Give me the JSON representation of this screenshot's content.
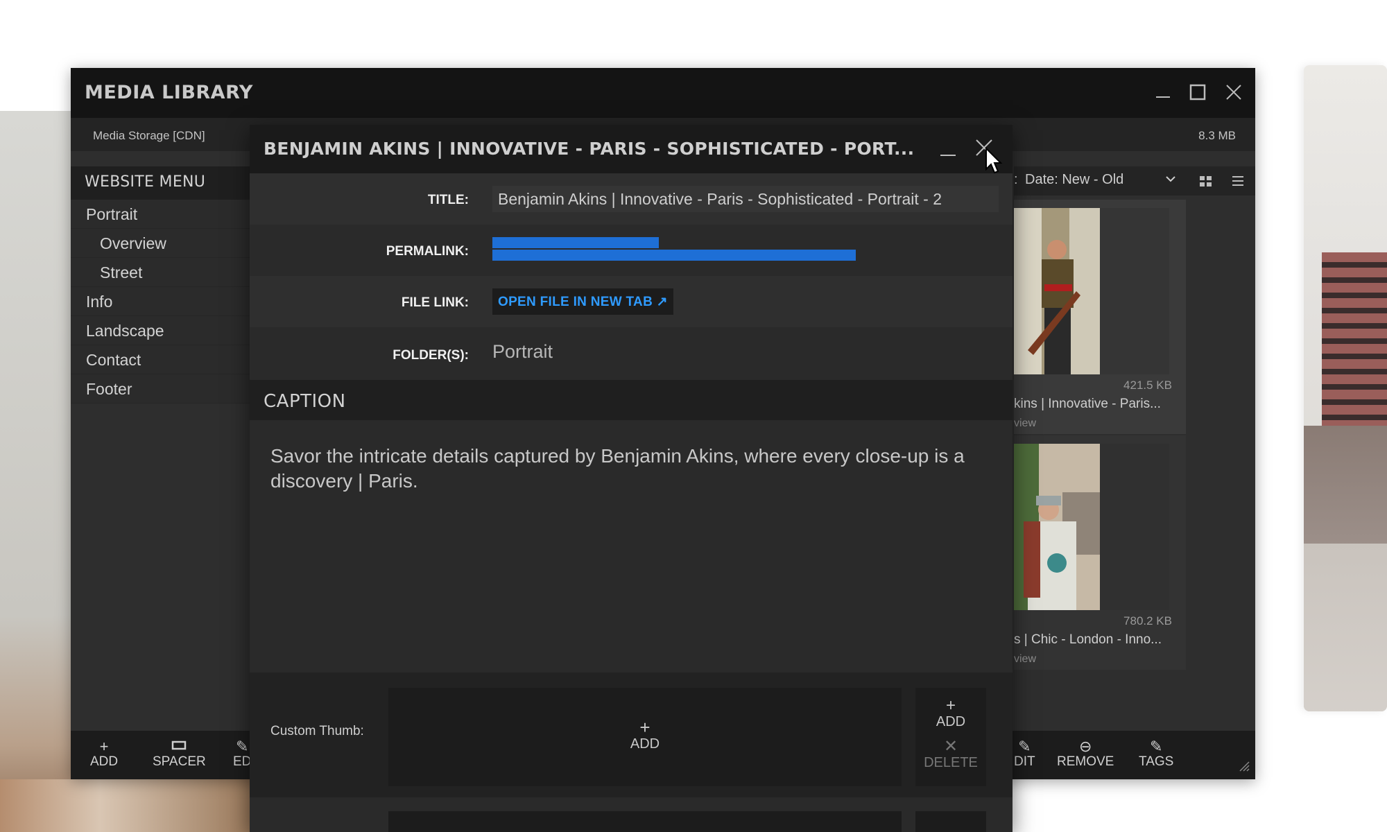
{
  "window": {
    "title": "MEDIA LIBRARY",
    "storage_label": "Media Storage [CDN]",
    "storage_size": "8.3 MB"
  },
  "sidebar": {
    "heading": "WEBSITE MENU",
    "items": [
      {
        "label": "Portrait",
        "level": 0
      },
      {
        "label": "Overview",
        "level": 1
      },
      {
        "label": "Street",
        "level": 1
      },
      {
        "label": "Info",
        "level": 0
      },
      {
        "label": "Landscape",
        "level": 0
      },
      {
        "label": "Contact",
        "level": 0
      },
      {
        "label": "Footer",
        "level": 0
      }
    ]
  },
  "sort": {
    "selected": "Date: New - Old",
    "prefix": ":"
  },
  "cards": [
    {
      "size": "421.5 KB",
      "name": "kins | Innovative - Paris...",
      "sub": "view"
    },
    {
      "size": "780.2 KB",
      "name": "s | Chic - London - Inno...",
      "sub": "view"
    }
  ],
  "toolbar": {
    "add": "ADD",
    "spacer": "SPACER",
    "edit_left": "ED",
    "edit_right": "DIT",
    "remove": "REMOVE",
    "tags": "TAGS"
  },
  "modal": {
    "title": "BENJAMIN AKINS | INNOVATIVE - PARIS - SOPHISTICATED - PORT...",
    "title_label": "TITLE:",
    "title_value": "Benjamin Akins | Innovative - Paris - Sophisticated - Portrait - 2",
    "permalink_label": "PERMALINK:",
    "filelink_label": "FILE LINK:",
    "filelink_button": "OPEN FILE IN NEW TAB ↗",
    "folder_label": "FOLDER(S):",
    "folder_value": "Portrait",
    "caption_heading": "CAPTION",
    "caption_text": "Savor the intricate details captured by Benjamin Akins, where every close-up is a discovery | Paris.",
    "custom_thumb_label": "Custom Thumb:",
    "thumb_add": "ADD",
    "side_add": "ADD",
    "side_delete": "DELETE"
  },
  "colors": {
    "accent_link": "#2f9bff",
    "selection": "#1e6fd6",
    "titlebar": "#141414",
    "panel": "#2e2e2e"
  },
  "icons": [
    "minimize-icon",
    "maximize-icon",
    "close-icon",
    "chevron-down-icon",
    "grid-view-icon",
    "list-view-icon",
    "plus-icon",
    "spacer-icon",
    "pencil-icon",
    "remove-icon",
    "x-icon",
    "resize-grip-icon",
    "mouse-cursor-icon"
  ]
}
